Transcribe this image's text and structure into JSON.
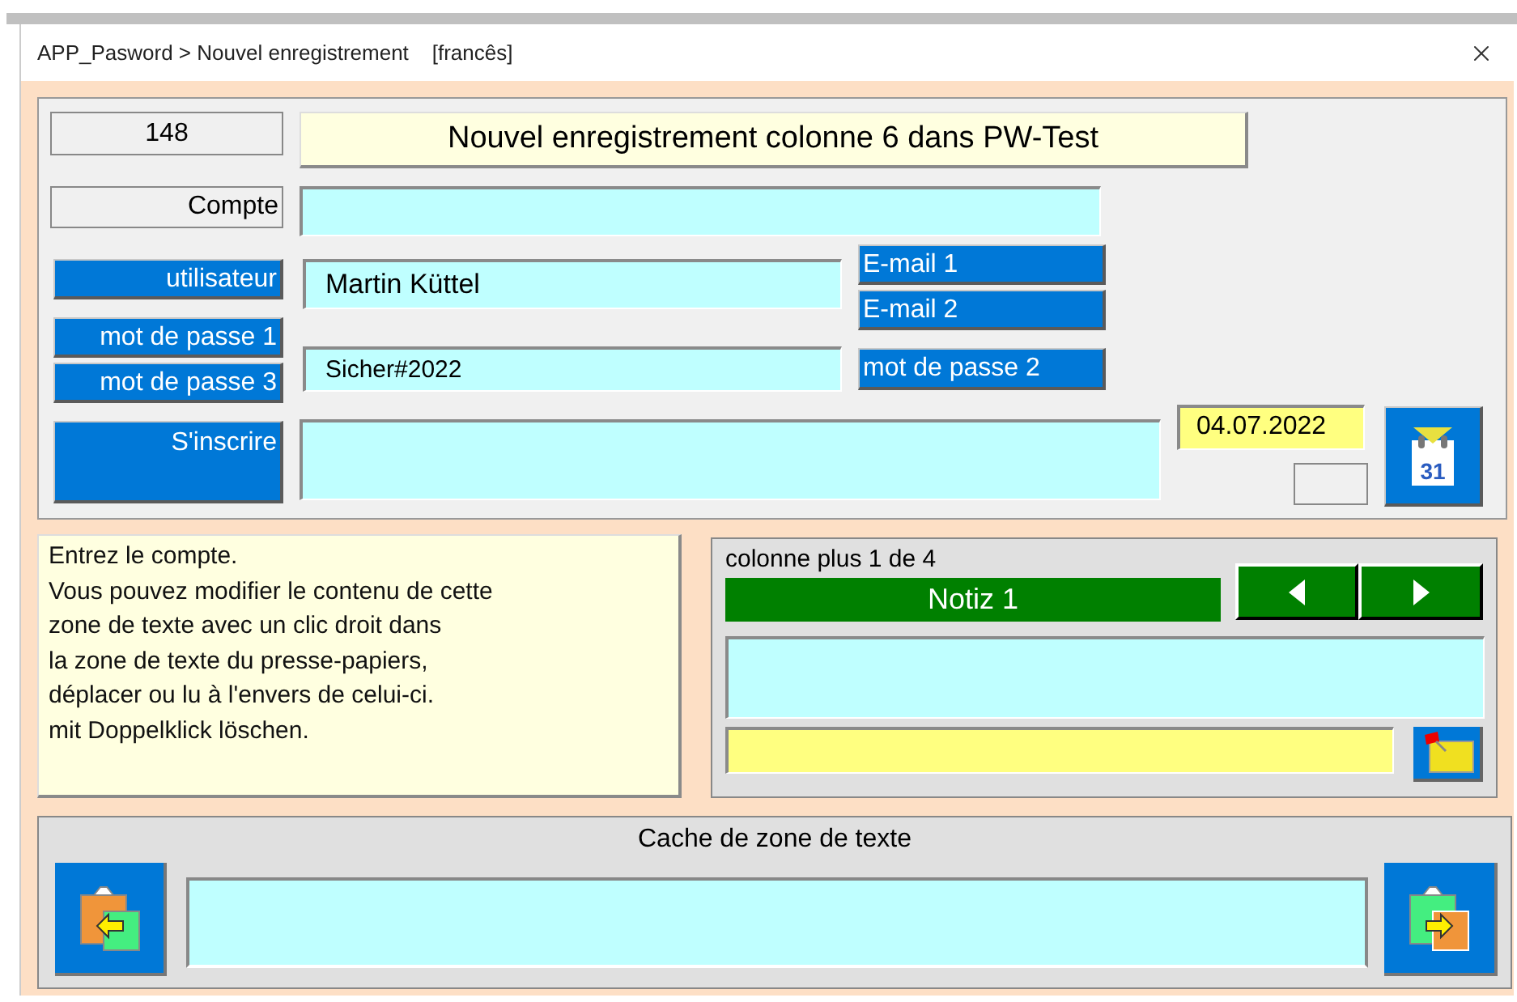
{
  "window": {
    "title": "APP_Pasword > Nouvel enregistrement    [francês]"
  },
  "record": {
    "number": "148",
    "heading": "Nouvel enregistrement colonne 6 dans PW-Test"
  },
  "account": {
    "label": "Compte"
  },
  "user": {
    "label": "utilisateur",
    "value": "Martin Küttel"
  },
  "email_buttons": [
    "E-mail 1",
    "E-mail 2"
  ],
  "password_buttons": [
    "mot de passe 1",
    "mot de passe 3"
  ],
  "password": {
    "value": "Sicher#2022"
  },
  "password2_button": "mot de passe 2",
  "register": {
    "label": "S'inscrire"
  },
  "date": "04.07.2022",
  "calendar_day": "31",
  "help_text": [
    "Entrez le compte.",
    "Vous pouvez modifier le contenu de cette",
    "zone de texte avec un clic droit dans",
    "la zone de texte du presse-papiers,",
    "déplacer ou lu à l'envers de celui-ci.",
    "mit Doppelklick löschen."
  ],
  "notes": {
    "caption": "colonne plus 1 de 4",
    "title": "Notiz 1"
  },
  "cache": {
    "title": "Cache de zone de texte"
  }
}
